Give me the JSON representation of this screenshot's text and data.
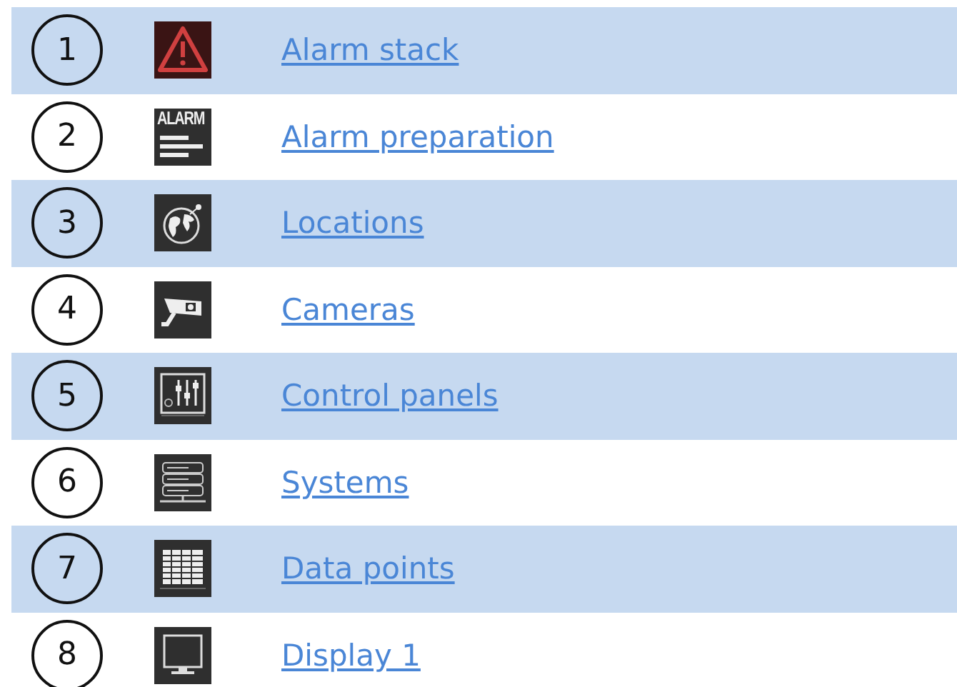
{
  "items": [
    {
      "number": "1",
      "kind": "warning",
      "link": "Alarm stack",
      "highlighted": true
    },
    {
      "number": "2",
      "kind": "alarm",
      "icon_label": "ALARM",
      "link": "Alarm preparation",
      "highlighted": false
    },
    {
      "number": "3",
      "kind": "globe",
      "link": "Locations",
      "highlighted": true
    },
    {
      "number": "4",
      "kind": "camera",
      "link": "Cameras",
      "highlighted": false
    },
    {
      "number": "5",
      "kind": "mixer",
      "link": "Control panels",
      "highlighted": true
    },
    {
      "number": "6",
      "kind": "server",
      "link": "Systems",
      "highlighted": false
    },
    {
      "number": "7",
      "kind": "table",
      "link": "Data points",
      "highlighted": true
    },
    {
      "number": "8",
      "kind": "monitor",
      "link": "Display 1",
      "highlighted": false
    }
  ]
}
